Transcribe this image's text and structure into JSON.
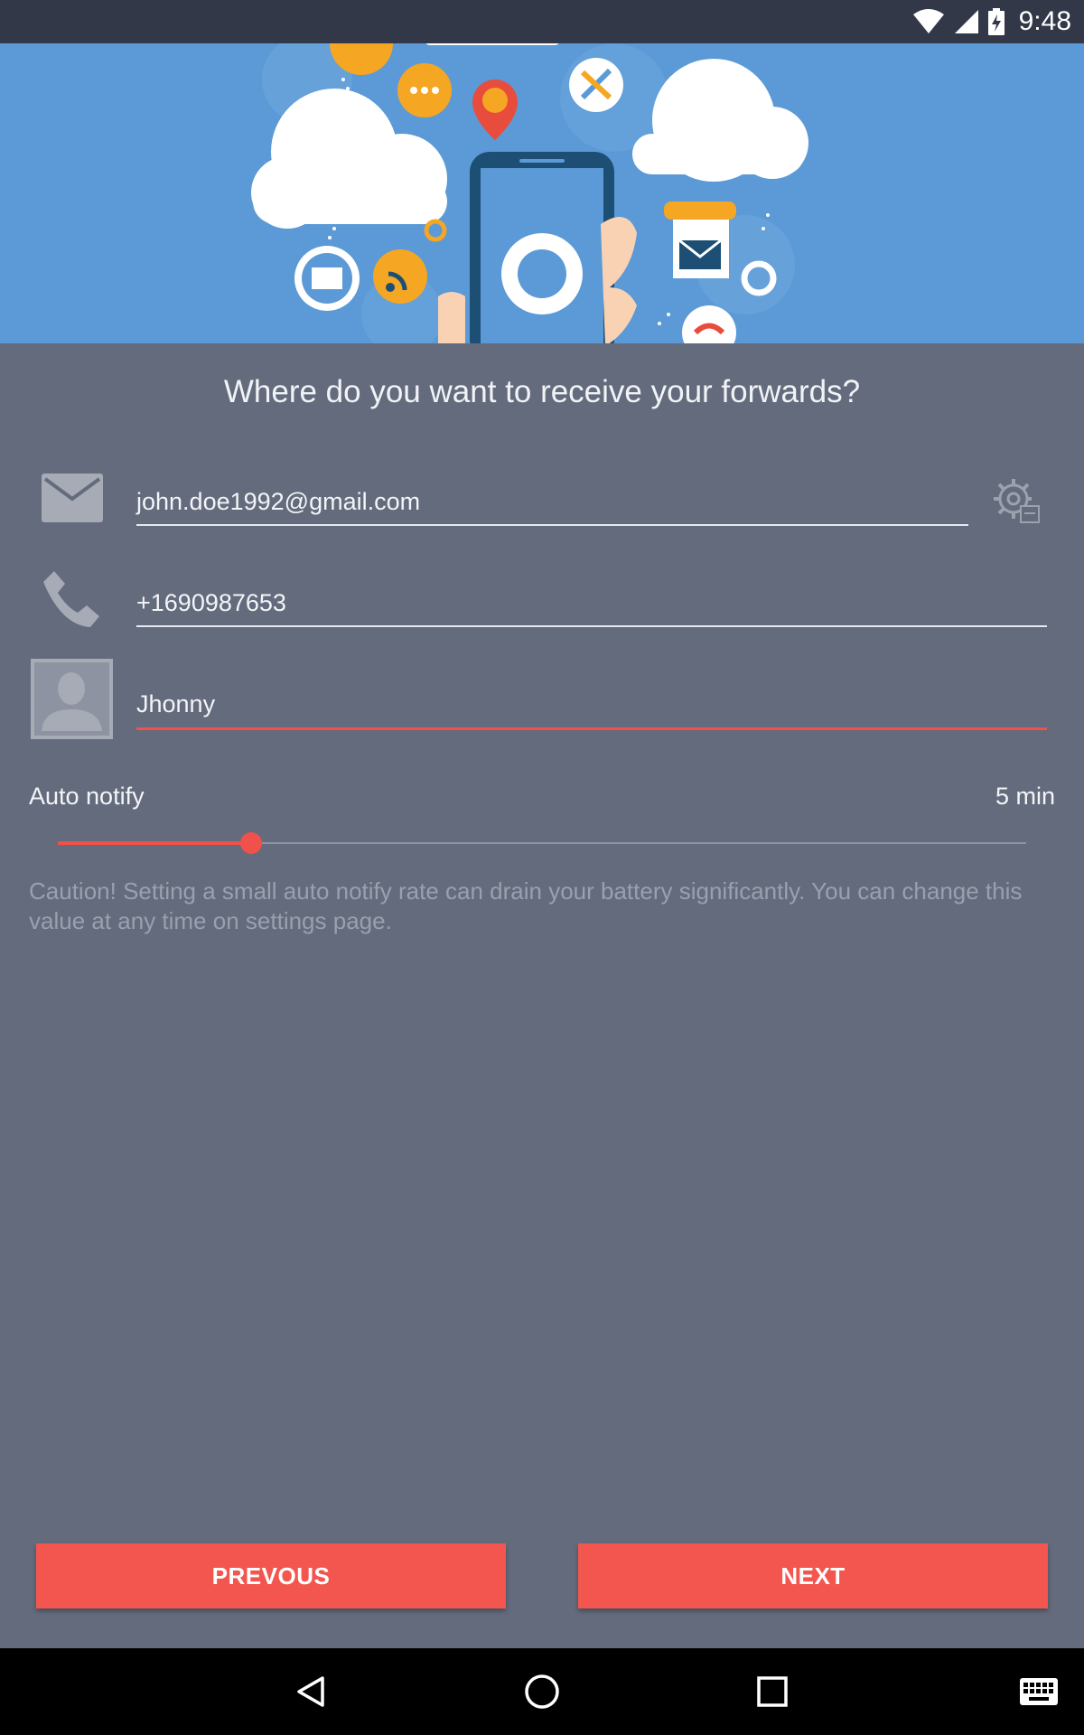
{
  "status_bar": {
    "time": "9:48"
  },
  "question": "Where do you want to receive your forwards?",
  "form": {
    "email": "john.doe1992@gmail.com",
    "phone": "+1690987653",
    "name": "Jhonny"
  },
  "auto_notify": {
    "label": "Auto notify",
    "value_text": "5 min",
    "slider_fraction": 0.2
  },
  "caution": "Caution! Setting a small auto notify rate can drain your battery significantly. You can change this value at any time on settings page.",
  "buttons": {
    "previous": "PREVOUS",
    "next": "NEXT"
  },
  "icons": {
    "status": [
      "wifi-icon",
      "cell-signal-icon",
      "battery-charging-icon"
    ],
    "form": [
      "email-icon",
      "phone-icon",
      "contact-avatar-icon",
      "settings-gear-icon"
    ],
    "nav": [
      "back-icon",
      "home-icon",
      "recents-icon",
      "keyboard-icon"
    ]
  },
  "colors": {
    "accent": "#f0514b",
    "background": "#636b7d",
    "hero": "#5b9ad6",
    "status_bar": "#323848"
  }
}
